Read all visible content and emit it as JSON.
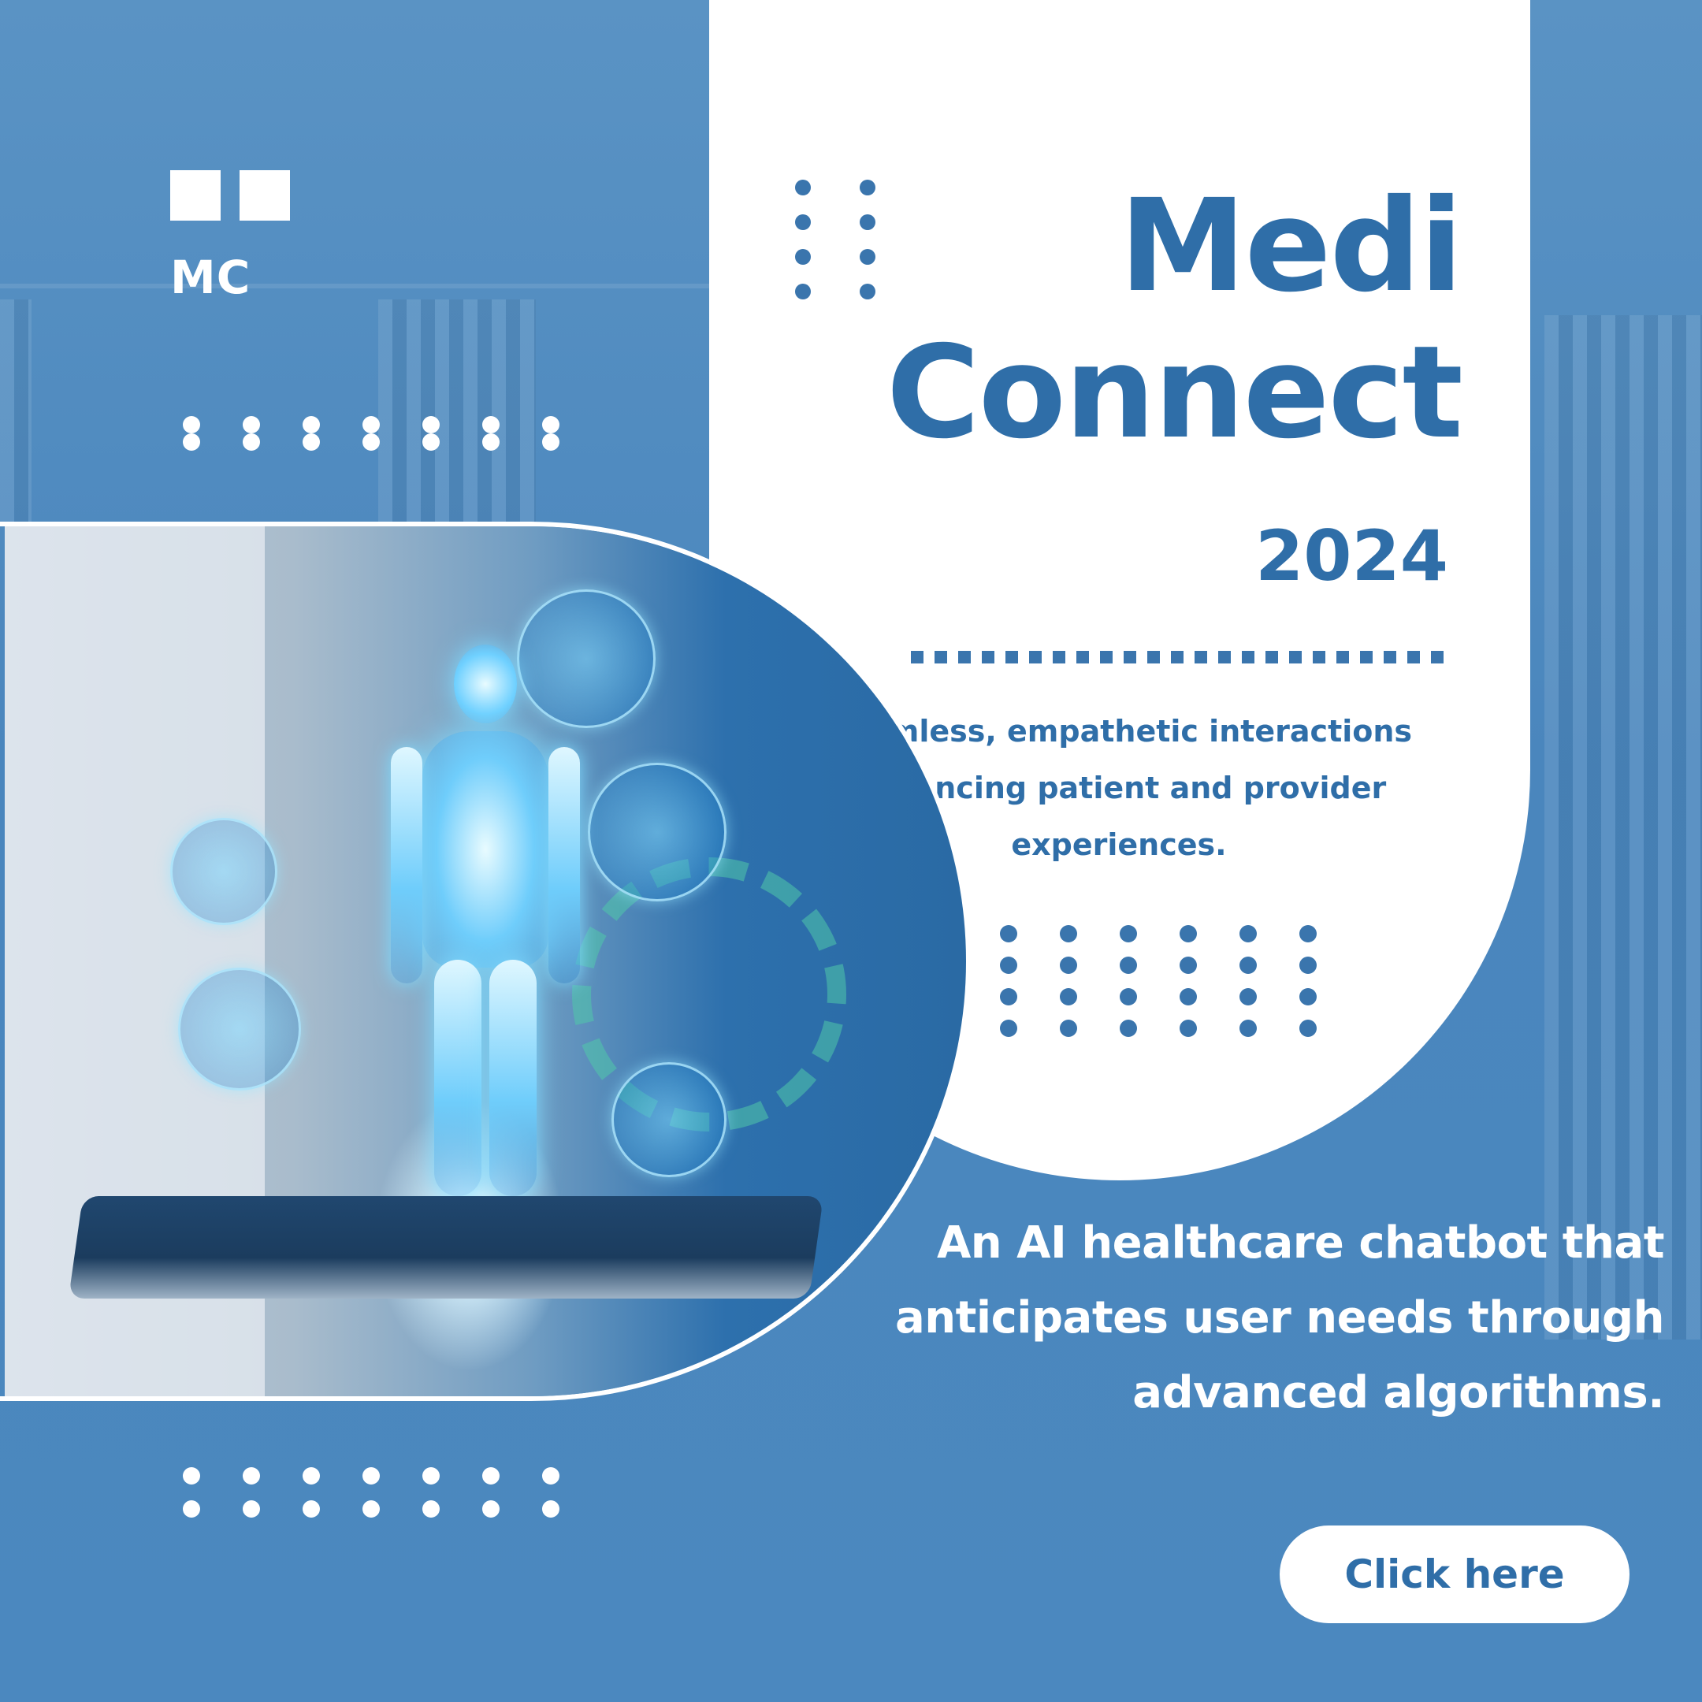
{
  "brand": {
    "logo_text": "MC"
  },
  "hero": {
    "title_line1": "Medi",
    "title_line2": "Connect",
    "year": "2024",
    "tagline": "Seamless, empathetic interactions enhancing patient and provider experiences."
  },
  "description": "An AI healthcare chatbot that anticipates user needs through advanced algorithms.",
  "cta": {
    "label": "Click here"
  },
  "colors": {
    "primary": "#2f6ea8",
    "background": "#4b88bf",
    "panel": "#ffffff"
  }
}
